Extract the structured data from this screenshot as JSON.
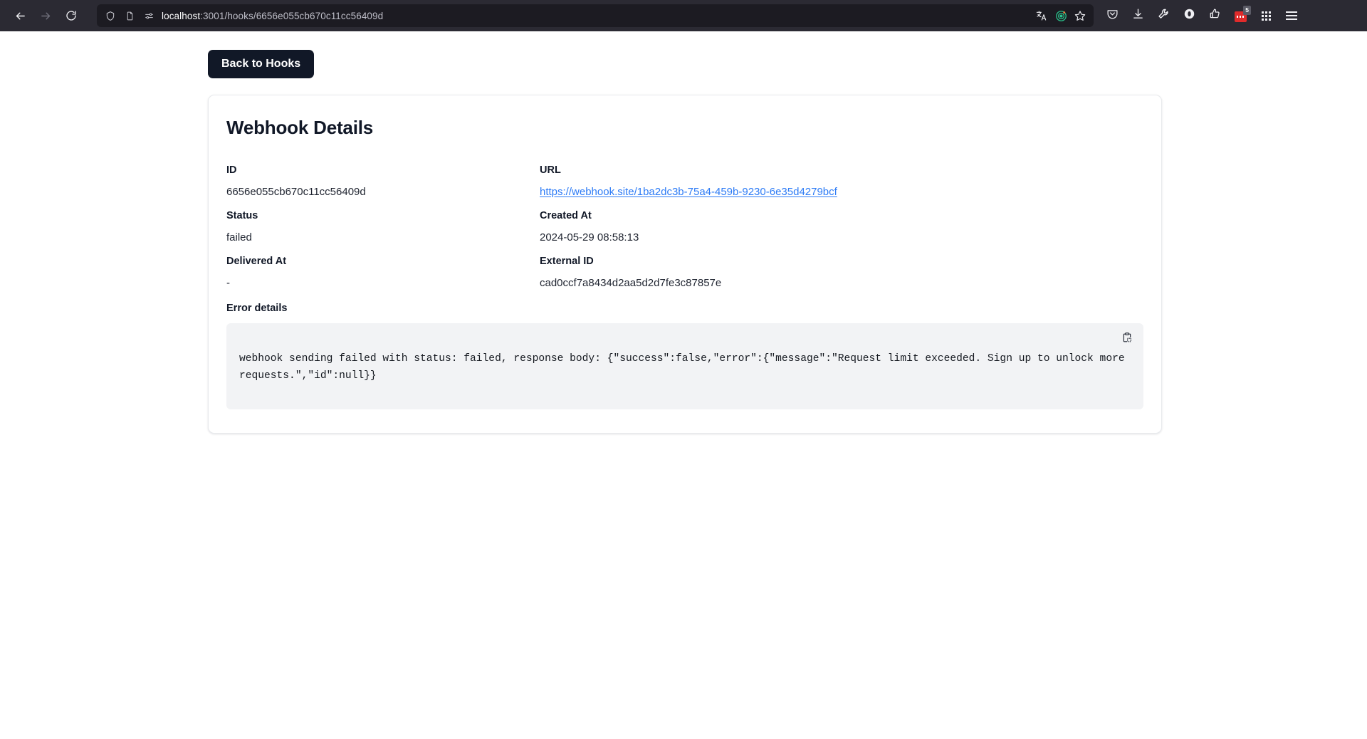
{
  "browser": {
    "nav": {
      "back_icon": "back-arrow-icon",
      "forward_icon": "forward-arrow-icon",
      "reload_icon": "reload-icon"
    },
    "address_bar": {
      "shield_icon": "shield-icon",
      "page_icon": "page-document-icon",
      "permissions_icon": "permissions-icon",
      "url_host": "localhost",
      "url_path": ":3001/hooks/6656e055cb670c11cc56409d",
      "translate_icon": "translate-icon",
      "reader_icon": "reader-target-icon",
      "bookmark_icon": "star-bookmark-icon"
    },
    "toolbar": [
      {
        "name": "pocket-icon"
      },
      {
        "name": "downloads-icon"
      },
      {
        "name": "wrench-icon"
      },
      {
        "name": "opera-circle-icon"
      },
      {
        "name": "thumbs-up-extension-icon"
      },
      {
        "name": "red-extension-icon",
        "badge": "5"
      },
      {
        "name": "apps-grid-icon"
      },
      {
        "name": "hamburger-menu-icon"
      }
    ]
  },
  "page": {
    "back_button_label": "Back to Hooks",
    "card_title": "Webhook Details",
    "details": [
      {
        "label": "ID",
        "value": "6656e055cb670c11cc56409d"
      },
      {
        "label": "URL",
        "value": "https://webhook.site/1ba2dc3b-75a4-459b-9230-6e35d4279bcf",
        "is_link": true
      },
      {
        "label": "Status",
        "value": "failed"
      },
      {
        "label": "Created At",
        "value": "2024-05-29 08:58:13"
      },
      {
        "label": "Delivered At",
        "value": "-"
      },
      {
        "label": "External ID",
        "value": "cad0ccf7a8434d2aa5d2d7fe3c87857e"
      }
    ],
    "error_label": "Error details",
    "error_text": "webhook sending failed with status: failed, response body: {\"success\":false,\"error\":{\"message\":\"Request limit exceeded. Sign up to unlock more requests.\",\"id\":null}}",
    "copy_icon": "clipboard-copy-icon"
  },
  "colors": {
    "button_bg": "#111827",
    "link": "#2e7cf6",
    "chrome_bg": "#2b2a33",
    "urlbar_bg": "#1c1b22",
    "code_bg": "#f2f3f5"
  }
}
